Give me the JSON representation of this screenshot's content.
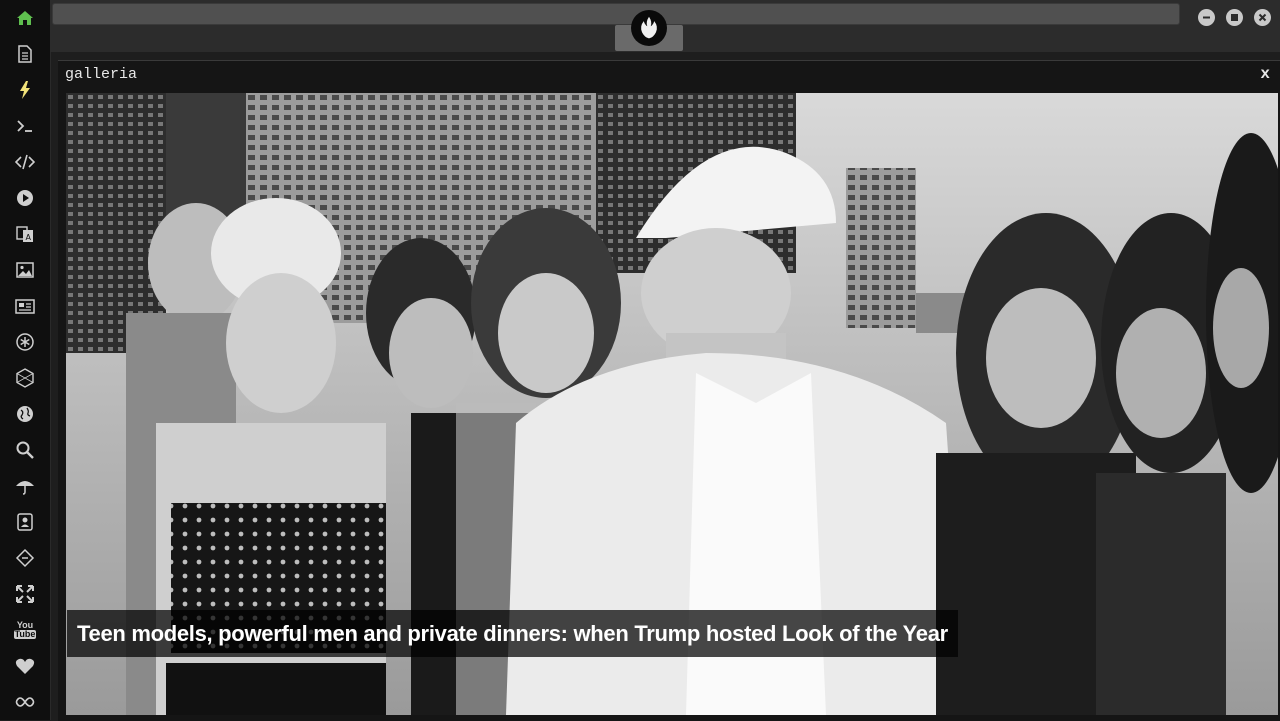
{
  "panel": {
    "title": "galleria",
    "close_label": "x"
  },
  "gallery": {
    "caption": "Teen models, powerful men and private dinners: when Trump hosted Look of the Year"
  },
  "sidebar": {
    "icons": [
      "home-icon",
      "document-icon",
      "lightning-icon",
      "terminal-icon",
      "code-icon",
      "play-icon",
      "translate-icon",
      "image-icon",
      "news-icon",
      "asterisk-icon",
      "hexagon-icon",
      "globe-icon",
      "search-icon",
      "umbrella-icon",
      "contact-card-icon",
      "link-code-icon",
      "expand-icon",
      "youtube-icon",
      "heart-icon",
      "infinity-icon"
    ],
    "youtube_label_top": "You",
    "youtube_label_bottom": "Tube",
    "active_color": "#5fbf4f"
  },
  "window": {
    "controls": [
      "minimize-icon",
      "maximize-icon",
      "close-icon"
    ]
  }
}
